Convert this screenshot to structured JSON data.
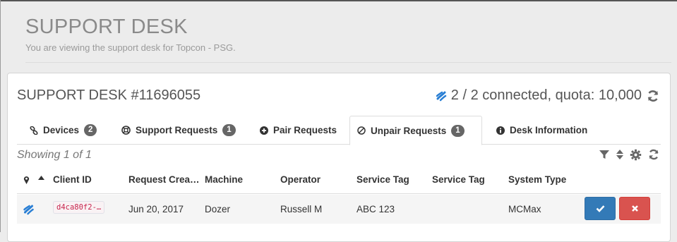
{
  "header": {
    "title": "SUPPORT DESK",
    "subtitle": "You are viewing the support desk for Topcon - PSG."
  },
  "desk": {
    "title": "SUPPORT DESK #11696055",
    "connection_text": "2 / 2 connected, quota: 10,000"
  },
  "tabs": [
    {
      "label": "Devices",
      "count": "2",
      "icon": "link-icon"
    },
    {
      "label": "Support Requests",
      "count": "1",
      "icon": "lifebuoy-icon"
    },
    {
      "label": "Pair Requests",
      "count": "",
      "icon": "plus-circle-icon"
    },
    {
      "label": "Unpair Requests",
      "count": "1",
      "icon": "ban-icon",
      "active": true
    },
    {
      "label": "Desk Information",
      "count": "",
      "icon": "info-circle-icon"
    }
  ],
  "table": {
    "showing": "Showing 1 of 1",
    "columns": [
      "Client ID",
      "Request Crea…",
      "Machine",
      "Operator",
      "Service Tag",
      "Service Tag",
      "System Type"
    ],
    "rows": [
      {
        "client_id": "d4ca80f2-…",
        "request_created": "Jun 20, 2017",
        "machine": "Dozer",
        "operator": "Russell M",
        "service_tag_1": "ABC 123",
        "service_tag_2": "",
        "system_type": "MCMax"
      }
    ]
  },
  "colors": {
    "primary": "#337ab7",
    "danger": "#d9534f",
    "badge": "#666666",
    "code": "#c7254e"
  }
}
